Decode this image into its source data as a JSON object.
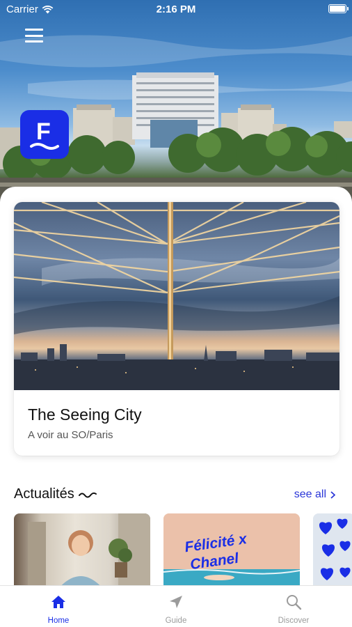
{
  "status_bar": {
    "carrier": "Carrier",
    "time": "2:16 PM"
  },
  "header": {
    "menu_icon": "hamburger-menu-icon",
    "logo_letter": "F",
    "brand_color": "#1a2ee6"
  },
  "featured": {
    "title": "The Seeing City",
    "subtitle": "A voir au SO/Paris"
  },
  "news": {
    "title": "Actualités",
    "see_all_label": "see all",
    "cards": [
      {
        "caption": ""
      },
      {
        "caption": "Félicité x Chanel"
      },
      {
        "caption": ""
      }
    ]
  },
  "tab_bar": {
    "accent_color": "#1a2ee6",
    "inactive_color": "#9b9b9b",
    "tabs": [
      {
        "label": "Home",
        "icon": "home-icon",
        "active": true
      },
      {
        "label": "Guide",
        "icon": "navigation-arrow-icon",
        "active": false
      },
      {
        "label": "Discover",
        "icon": "search-icon",
        "active": false
      }
    ]
  }
}
